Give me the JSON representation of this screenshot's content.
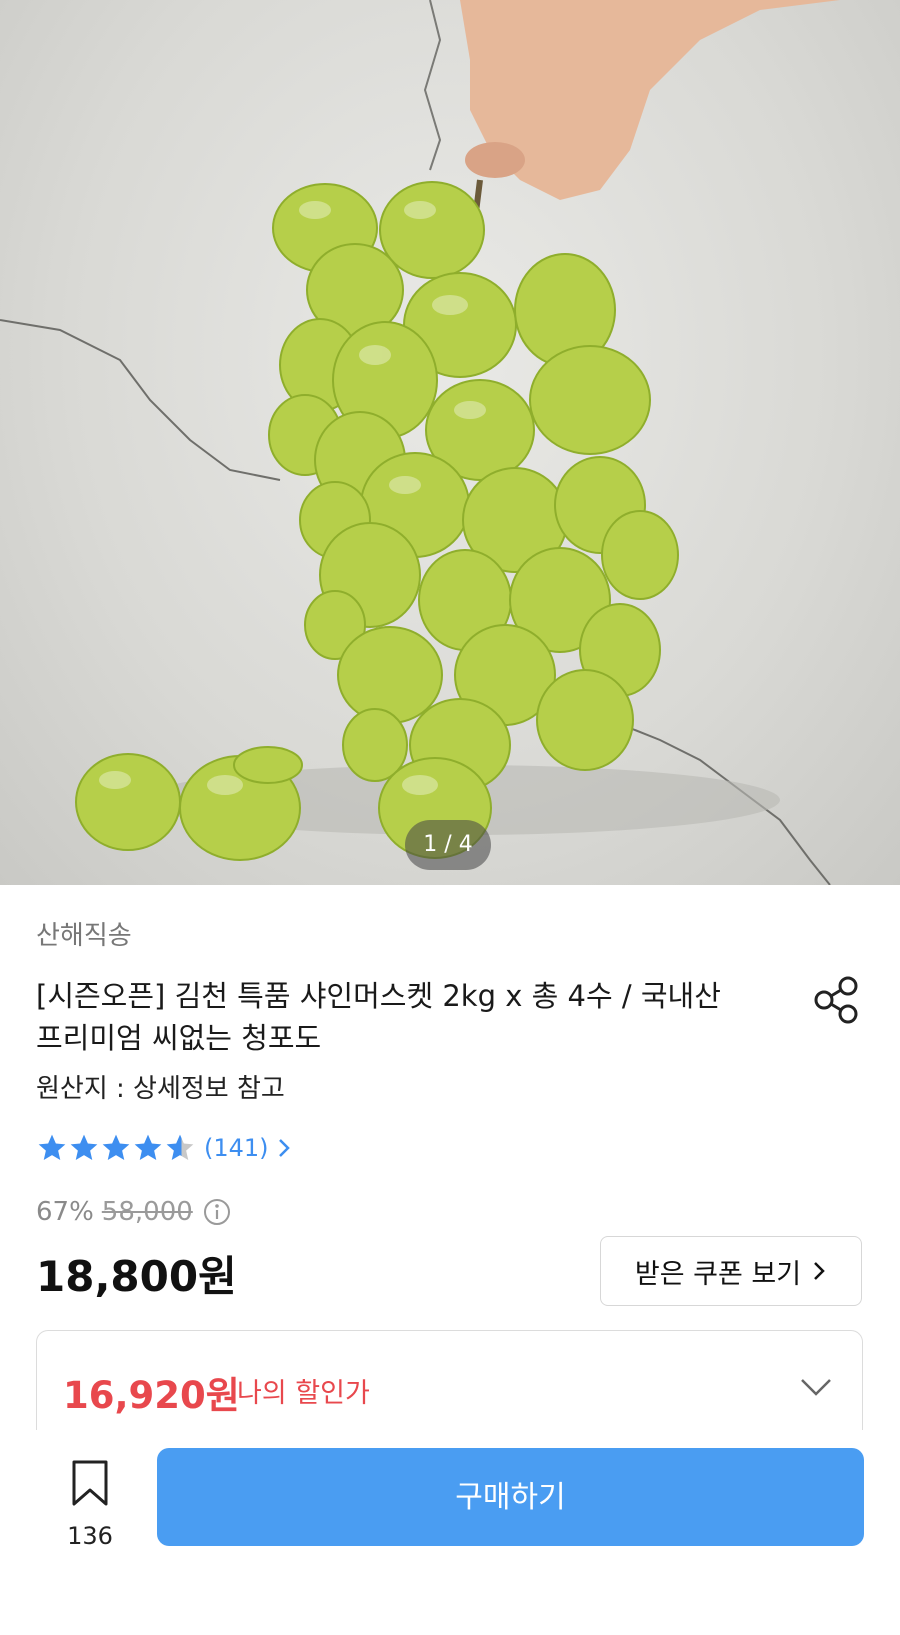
{
  "colors": {
    "accent_blue": "#4a9df2",
    "star_blue": "#3d8ef0",
    "discount_red": "#e8484d"
  },
  "gallery": {
    "image_alt": "Shine Muscat grape bunch held by hand",
    "indicator": "1 / 4"
  },
  "product": {
    "seller": "산해직송",
    "title": "[시즌오픈] 김천 특품 샤인머스켓 2kg x 총 4수 / 국내산 프리미엄 씨없는 청포도",
    "origin": "원산지 : 상세정보 참고",
    "rating": {
      "value": 4.6,
      "max": 5,
      "count_text": "(141)"
    },
    "pricing": {
      "discount_rate": "67%",
      "original_price": "58,000",
      "sale_price": "18,800원",
      "coupon_button": "받은 쿠폰 보기",
      "my_price": "16,920원",
      "my_price_label": "나의 할인가"
    }
  },
  "bottom_bar": {
    "bookmark_count": "136",
    "buy_button": "구매하기"
  }
}
